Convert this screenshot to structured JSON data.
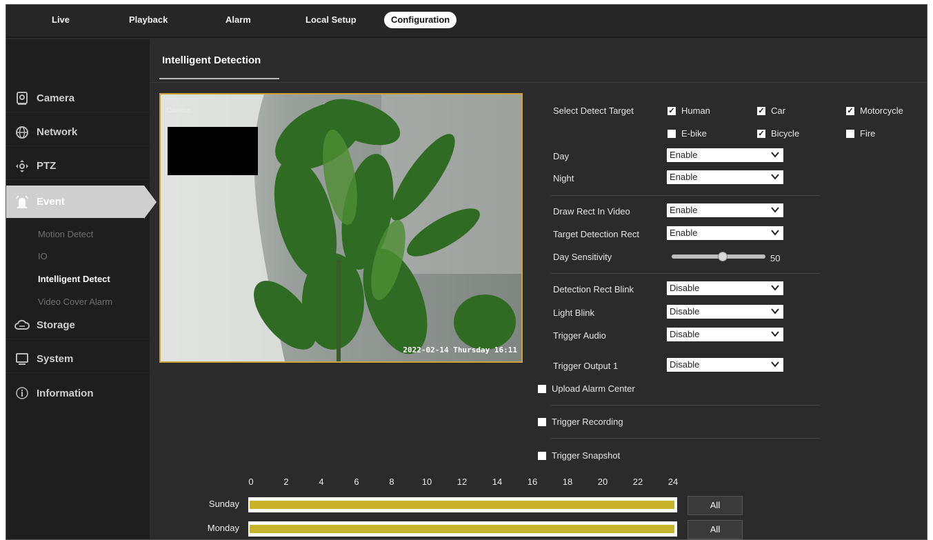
{
  "nav": {
    "tabs": [
      "Live",
      "Playback",
      "Alarm",
      "Local Setup",
      "Configuration"
    ],
    "active": "Configuration"
  },
  "sidebar": {
    "items": [
      "Camera",
      "Network",
      "PTZ",
      "Event",
      "Storage",
      "System",
      "Information"
    ],
    "active": "Event",
    "event_sub": [
      "Motion Detect",
      "IO",
      "Intelligent Detect",
      "Video Cover Alarm"
    ],
    "active_sub": "Intelligent Detect"
  },
  "page": {
    "title": "Intelligent Detection"
  },
  "video": {
    "channel_name": "Camera",
    "osd_time": "2022-02-14 Thursday 16:11"
  },
  "detect": {
    "label": "Select Detect Target",
    "targets": [
      {
        "name": "Human",
        "checked": true
      },
      {
        "name": "Car",
        "checked": true
      },
      {
        "name": "Motorcycle",
        "checked": true
      },
      {
        "name": "E-bike",
        "checked": false
      },
      {
        "name": "Bicycle",
        "checked": true
      },
      {
        "name": "Fire",
        "checked": false
      }
    ]
  },
  "fields": {
    "day": {
      "label": "Day",
      "value": "Enable"
    },
    "night": {
      "label": "Night",
      "value": "Enable"
    },
    "draw_rect": {
      "label": "Draw Rect In Video",
      "value": "Enable"
    },
    "target_rect": {
      "label": "Target Detection Rect",
      "value": "Enable"
    },
    "day_sensitivity": {
      "label": "Day Sensitivity",
      "value": "50",
      "fraction": 0.5
    },
    "rect_blink": {
      "label": "Detection Rect Blink",
      "value": "Disable"
    },
    "light_blink": {
      "label": "Light Blink",
      "value": "Disable"
    },
    "trigger_audio": {
      "label": "Trigger Audio",
      "value": "Disable"
    },
    "trigger_output": {
      "label": "Trigger Output 1",
      "value": "Disable"
    }
  },
  "checks": {
    "upload_alarm": {
      "label": "Upload Alarm Center",
      "checked": false
    },
    "trigger_recording": {
      "label": "Trigger Recording",
      "checked": false
    },
    "trigger_snapshot": {
      "label": "Trigger Snapshot",
      "checked": false
    }
  },
  "schedule": {
    "hours": [
      "0",
      "2",
      "4",
      "6",
      "8",
      "10",
      "12",
      "14",
      "16",
      "18",
      "20",
      "22",
      "24"
    ],
    "days": [
      {
        "name": "Sunday",
        "all_label": "All"
      },
      {
        "name": "Monday",
        "all_label": "All"
      }
    ]
  },
  "colors": {
    "accent_gold": "#c8b32c",
    "video_border": "#c7a33a"
  }
}
